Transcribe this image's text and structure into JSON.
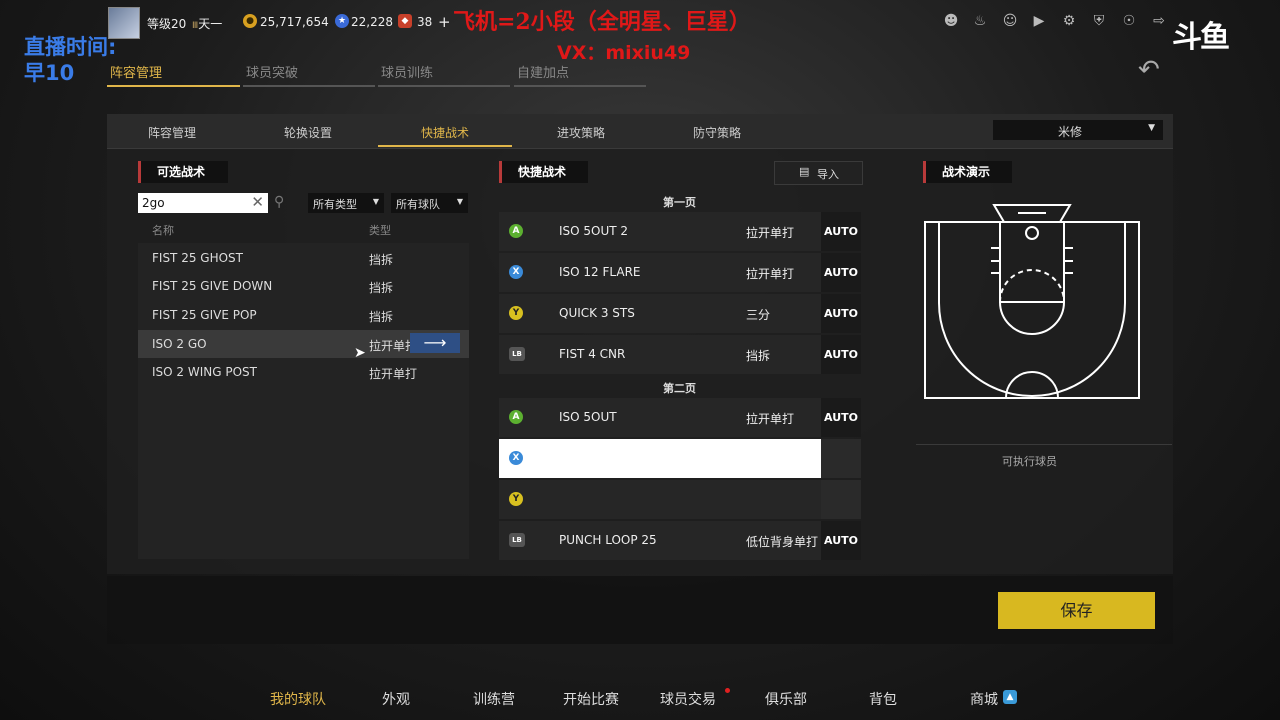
{
  "player": {
    "level": "等级20",
    "rank_badge": "Ⅲ",
    "rank_name": "天一"
  },
  "currencies": [
    {
      "icon": "coin-icon",
      "value": "25,717,654",
      "color": "#d8a020"
    },
    {
      "icon": "star-token-icon",
      "value": "22,228",
      "color": "#3a6ad8"
    },
    {
      "icon": "points-icon",
      "value": "38",
      "color": "#c8402a"
    }
  ],
  "add_label": "+",
  "overlay": {
    "title": "飞机=2小段（全明星、巨星）",
    "vx": "VX：mixiu49",
    "stream_time": "直播时间:",
    "stream_time2": "早10"
  },
  "logo": "斗鱼",
  "main_tabs": [
    {
      "label": "阵容管理",
      "active": true
    },
    {
      "label": "球员突破",
      "active": false
    },
    {
      "label": "球员训练",
      "active": false
    },
    {
      "label": "自建加点",
      "active": false
    }
  ],
  "sub_tabs": [
    {
      "label": "阵容管理"
    },
    {
      "label": "轮换设置"
    },
    {
      "label": "快捷战术",
      "active": true
    },
    {
      "label": "进攻策略"
    },
    {
      "label": "防守策略"
    }
  ],
  "team_dropdown": "米修",
  "left_panel": {
    "title": "可选战术",
    "search_value": "2go",
    "filter_type": "所有类型",
    "filter_team": "所有球队",
    "col_name": "名称",
    "col_type": "类型",
    "rows": [
      {
        "name": "FIST 25 GHOST",
        "type": "挡拆"
      },
      {
        "name": "FIST 25 GIVE DOWN",
        "type": "挡拆"
      },
      {
        "name": "FIST 25 GIVE POP",
        "type": "挡拆"
      },
      {
        "name": "ISO 2 GO",
        "type": "拉开单打"
      },
      {
        "name": "ISO 2 WING POST",
        "type": "拉开单打"
      }
    ]
  },
  "middle_panel": {
    "title": "快捷战术",
    "import_label": "导入",
    "page1_label": "第一页",
    "page2_label": "第二页",
    "page1": [
      {
        "button": "A",
        "name": "ISO 5OUT 2",
        "type": "拉开单打",
        "auto": "AUTO"
      },
      {
        "button": "X",
        "name": "ISO 12 FLARE",
        "type": "拉开单打",
        "auto": "AUTO"
      },
      {
        "button": "Y",
        "name": "QUICK 3 STS",
        "type": "三分",
        "auto": "AUTO"
      },
      {
        "button": "LB",
        "name": "FIST 4 CNR",
        "type": "挡拆",
        "auto": "AUTO"
      }
    ],
    "page2": [
      {
        "button": "A",
        "name": "ISO 5OUT",
        "type": "拉开单打",
        "auto": "AUTO"
      },
      {
        "button": "X",
        "name": "",
        "type": "",
        "auto": ""
      },
      {
        "button": "Y",
        "name": "",
        "type": "",
        "auto": ""
      },
      {
        "button": "LB",
        "name": "PUNCH LOOP 25",
        "type": "低位背身单打",
        "auto": "AUTO"
      }
    ]
  },
  "right_panel": {
    "title": "战术演示",
    "exec_label": "可执行球员"
  },
  "save_label": "保存",
  "bottom_nav": [
    {
      "label": "我的球队",
      "active": true
    },
    {
      "label": "外观"
    },
    {
      "label": "训练营"
    },
    {
      "label": "开始比赛"
    },
    {
      "label": "球员交易"
    },
    {
      "label": "俱乐部"
    },
    {
      "label": "背包"
    },
    {
      "label": "商城"
    }
  ],
  "colors": {
    "accent": "#e0b64a",
    "save": "#d8b820",
    "overlay_red": "#e01818",
    "button_A": "#5cb030",
    "button_X": "#3a8ad8",
    "button_Y": "#d8c020"
  }
}
